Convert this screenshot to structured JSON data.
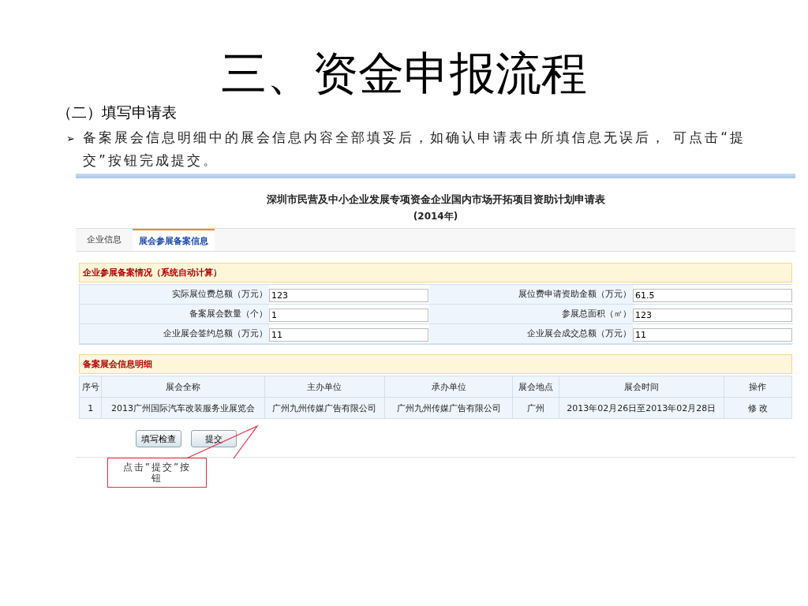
{
  "slide": {
    "title": "三、资金申报流程",
    "subtitle": "（二）填写申请表",
    "bullet": "➢",
    "paragraph": "备案展会信息明细中的展会信息内容全部填妥后，如确认申请表中所填信息无误后， 可点击“提交”按钮完成提交。"
  },
  "form": {
    "title": "深圳市民营及中小企业发展专项资金企业国内市场开拓项目资助计划申请表",
    "year": "(2014年)",
    "tabs": [
      {
        "label": "企业信息",
        "selected": false
      },
      {
        "label": "展会参展备案信息",
        "selected": true
      }
    ],
    "summary": {
      "heading": "企业参展备案情况（系统自动计算）",
      "fields": [
        {
          "label": "实际展位费总额（万元）",
          "value": "123"
        },
        {
          "label": "展位费申请资助金额（万元）",
          "value": "61.5"
        },
        {
          "label": "备案展会数量（个）",
          "value": "1"
        },
        {
          "label": "参展总面积（㎡）",
          "value": "123"
        },
        {
          "label": "企业展会签约总额（万元）",
          "value": "11"
        },
        {
          "label": "企业展会成交总额（万元）",
          "value": "11"
        }
      ]
    },
    "detail": {
      "heading": "备案展会信息明细",
      "columns": [
        "序号",
        "展会全称",
        "主办单位",
        "承办单位",
        "展会地点",
        "展会时间",
        "操作"
      ],
      "rows": [
        [
          "1",
          "2013广州国际汽车改装服务业展览会",
          "广州九州传媒广告有限公司",
          "广州九州传媒广告有限公司",
          "广州",
          "2013年02月26日至2013年02月28日",
          "修 改"
        ]
      ]
    },
    "buttons": [
      "填写检查",
      "提交"
    ]
  },
  "callout": {
    "text": "点击”提交”按钮"
  }
}
